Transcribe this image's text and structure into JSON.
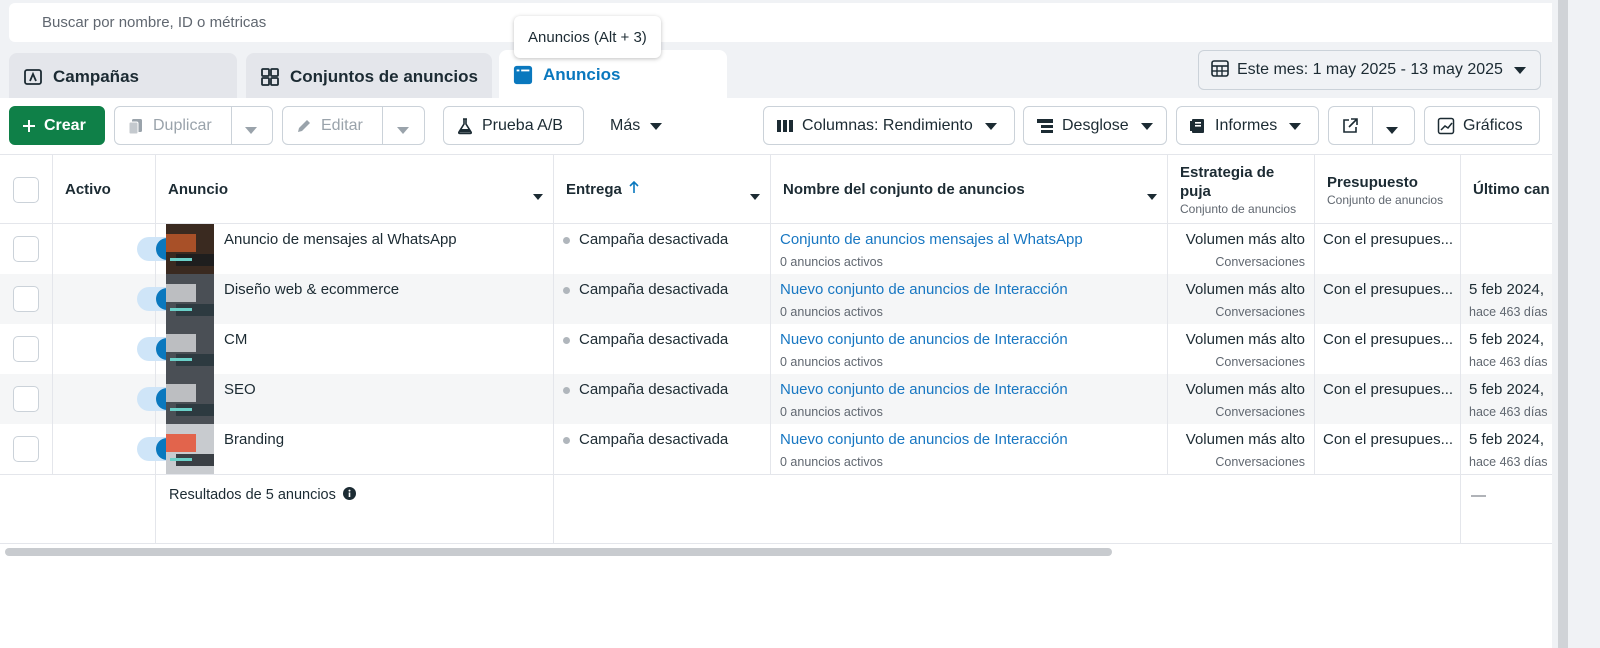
{
  "search": {
    "placeholder": "Buscar por nombre, ID o métricas"
  },
  "tabs": [
    {
      "label": "Campañas",
      "icon": "flag-icon"
    },
    {
      "label": "Conjuntos de anuncios",
      "icon": "grid-icon"
    },
    {
      "label": "Anuncios",
      "icon": "ad-icon"
    }
  ],
  "tooltip": "Anuncios (Alt + 3)",
  "date_range": {
    "label": "Este mes: 1 may 2025 - 13 may 2025"
  },
  "toolbar": {
    "create": "Crear",
    "duplicate": "Duplicar",
    "edit": "Editar",
    "ab_test": "Prueba A/B",
    "more": "Más",
    "columns": "Columnas: Rendimiento",
    "breakdown": "Desglose",
    "reports": "Informes",
    "charts": "Gráficos"
  },
  "table": {
    "headers": {
      "active": "Activo",
      "ad": "Anuncio",
      "delivery": "Entrega",
      "adset": "Nombre del conjunto de anuncios",
      "bid": "Estrategia de puja",
      "bid_sub": "Conjunto de anuncios",
      "budget": "Presupuesto",
      "budget_sub": "Conjunto de anuncios",
      "last": "Último can"
    },
    "rows": [
      {
        "name": "Anuncio de mensajes al WhatsApp",
        "delivery": "Campaña desactivada",
        "adset": "Conjunto de anuncios mensajes al WhatsApp",
        "adset_sub": "0 anuncios activos",
        "bid": "Volumen más alto",
        "bid_sub": "Conversaciones",
        "budget": "Con el presupues...",
        "last": "",
        "last_sub": ""
      },
      {
        "name": "Diseño web & ecommerce",
        "delivery": "Campaña desactivada",
        "adset": "Nuevo conjunto de anuncios de Interacción",
        "adset_sub": "0 anuncios activos",
        "bid": "Volumen más alto",
        "bid_sub": "Conversaciones",
        "budget": "Con el presupues...",
        "last": "5 feb 2024,",
        "last_sub": "hace 463 días"
      },
      {
        "name": "CM",
        "delivery": "Campaña desactivada",
        "adset": "Nuevo conjunto de anuncios de Interacción",
        "adset_sub": "0 anuncios activos",
        "bid": "Volumen más alto",
        "bid_sub": "Conversaciones",
        "budget": "Con el presupues...",
        "last": "5 feb 2024,",
        "last_sub": "hace 463 días"
      },
      {
        "name": "SEO",
        "delivery": "Campaña desactivada",
        "adset": "Nuevo conjunto de anuncios de Interacción",
        "adset_sub": "0 anuncios activos",
        "bid": "Volumen más alto",
        "bid_sub": "Conversaciones",
        "budget": "Con el presupues...",
        "last": "5 feb 2024,",
        "last_sub": "hace 463 días"
      },
      {
        "name": "Branding",
        "delivery": "Campaña desactivada",
        "adset": "Nuevo conjunto de anuncios de Interacción",
        "adset_sub": "0 anuncios activos",
        "bid": "Volumen más alto",
        "bid_sub": "Conversaciones",
        "budget": "Con el presupues...",
        "last": "5 feb 2024,",
        "last_sub": "hace 463 días"
      }
    ],
    "summary": "Resultados de 5 anuncios",
    "summary_last": "—"
  },
  "colors": {
    "accent": "#0a78be",
    "create": "#0f8048",
    "link": "#1877c2"
  }
}
